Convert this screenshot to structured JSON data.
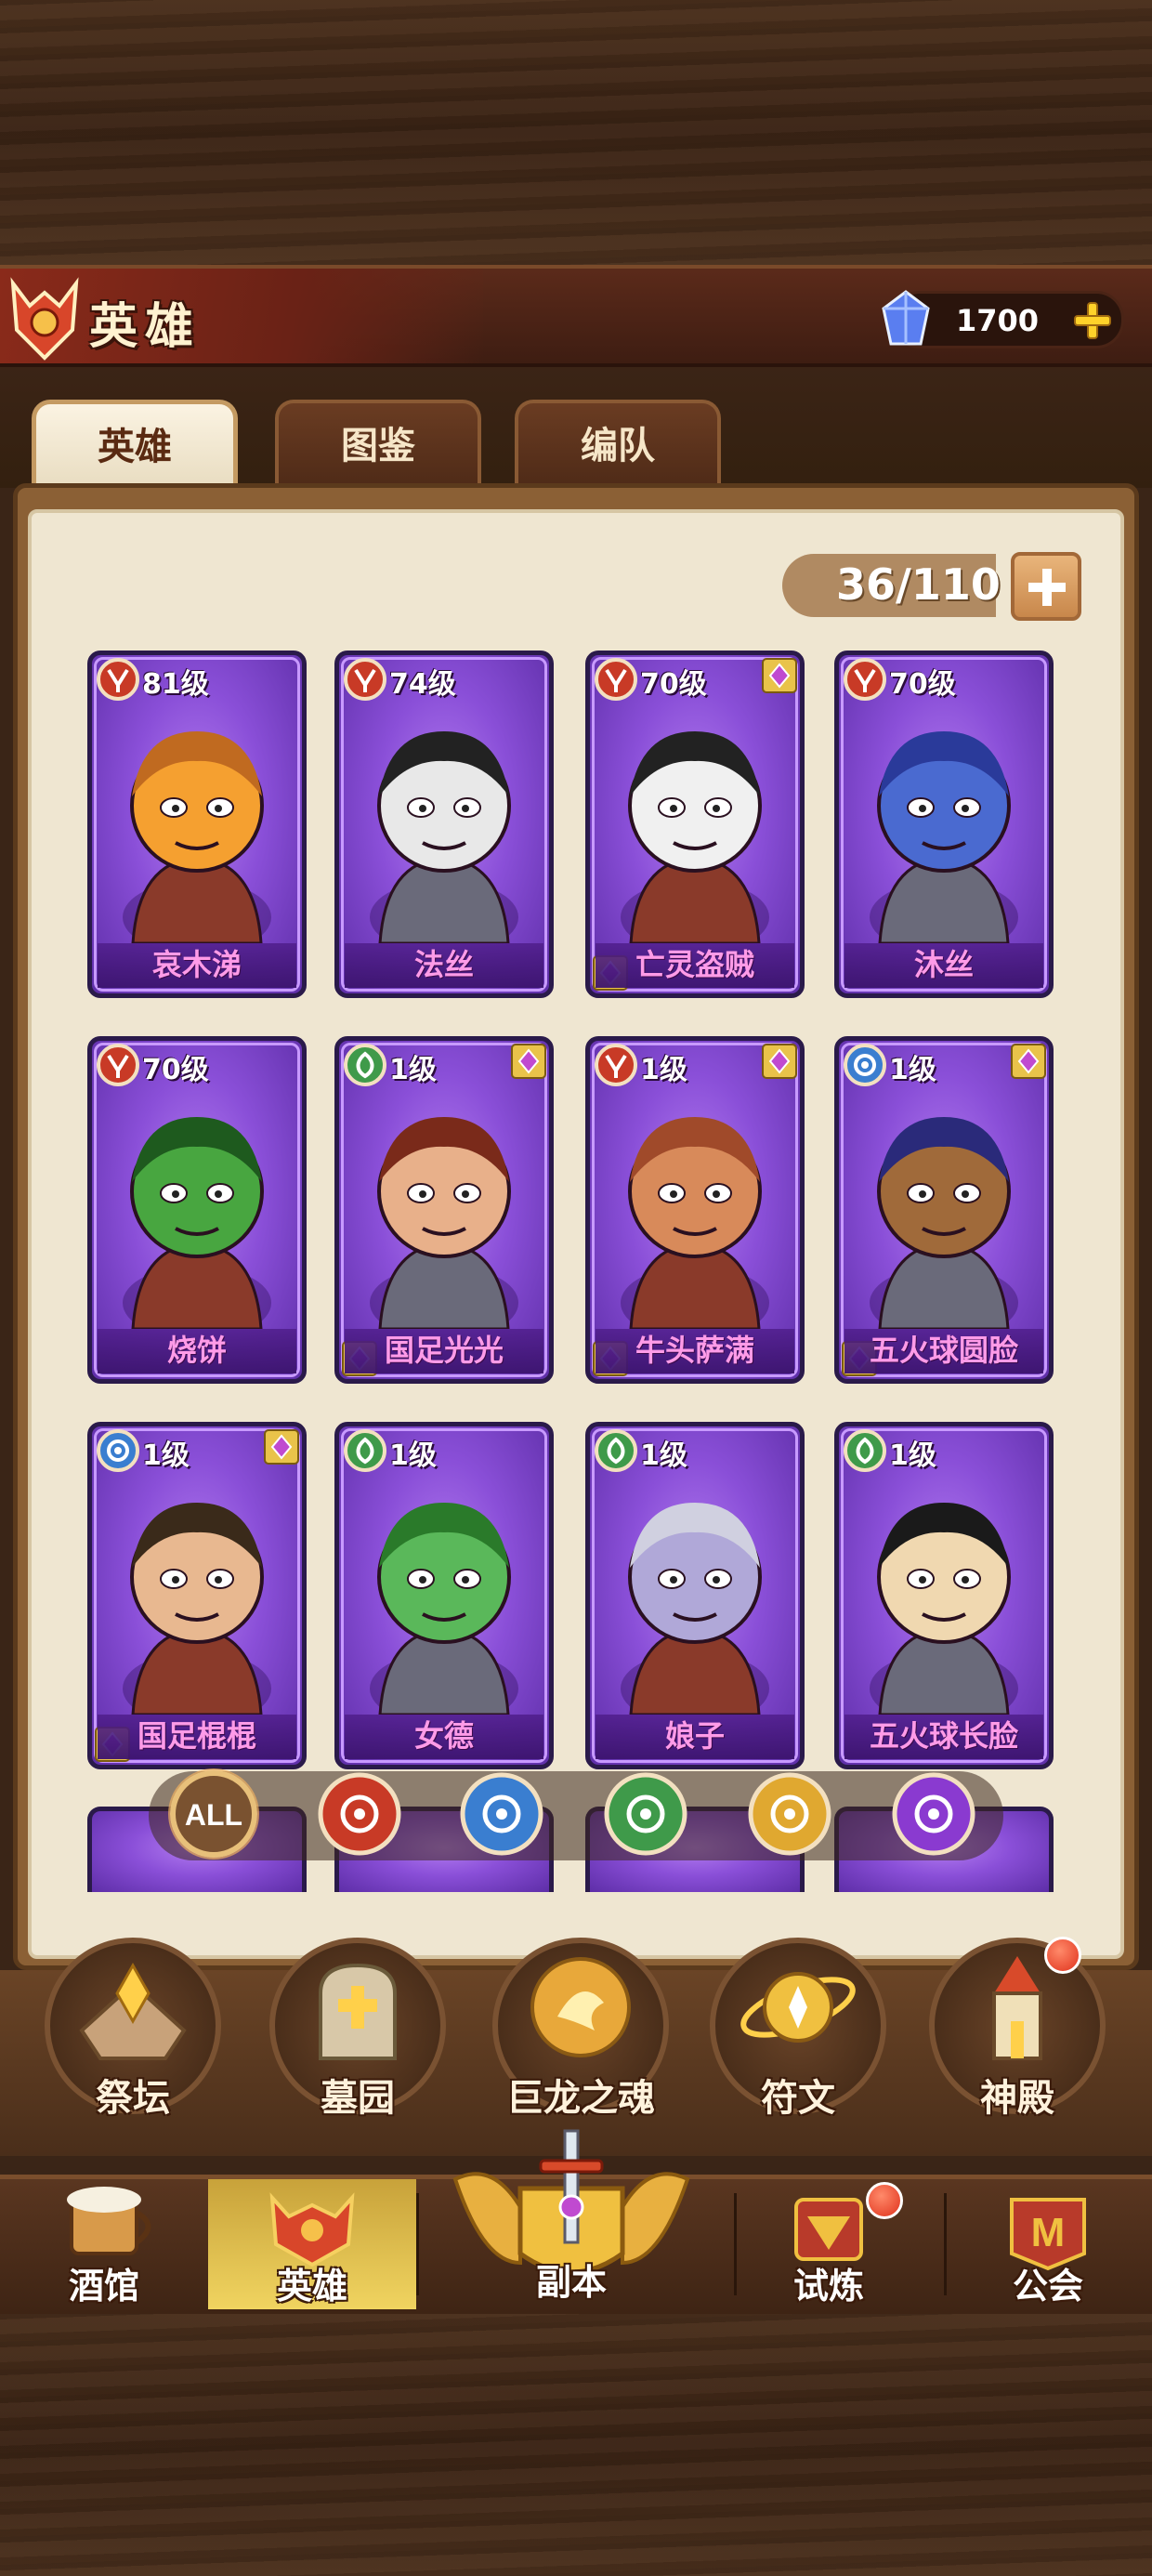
{
  "header": {
    "title": "英雄",
    "currency_value": "1700"
  },
  "tabs": [
    {
      "label": "英雄",
      "active": true
    },
    {
      "label": "图鉴",
      "active": false
    },
    {
      "label": "编队",
      "active": false
    }
  ],
  "hero_count": "36/110",
  "heroes": [
    {
      "level": "81级",
      "name": "哀木涕",
      "faction": "red",
      "rare": false
    },
    {
      "level": "74级",
      "name": "法丝",
      "faction": "red",
      "rare": false
    },
    {
      "level": "70级",
      "name": "亡灵盗贼",
      "faction": "red",
      "rare": true
    },
    {
      "level": "70级",
      "name": "沐丝",
      "faction": "red",
      "rare": false
    },
    {
      "level": "70级",
      "name": "烧饼",
      "faction": "red",
      "rare": false
    },
    {
      "level": "1级",
      "name": "国足光光",
      "faction": "green",
      "rare": true
    },
    {
      "level": "1级",
      "name": "牛头萨满",
      "faction": "red",
      "rare": true
    },
    {
      "level": "1级",
      "name": "五火球圆脸",
      "faction": "blue",
      "rare": true
    },
    {
      "level": "1级",
      "name": "国足棍棍",
      "faction": "blue",
      "rare": true
    },
    {
      "level": "1级",
      "name": "女德",
      "faction": "green",
      "rare": false
    },
    {
      "level": "1级",
      "name": "娘子",
      "faction": "green",
      "rare": false
    },
    {
      "level": "1级",
      "name": "五火球长脸",
      "faction": "green",
      "rare": false
    }
  ],
  "filters": [
    {
      "label": "ALL",
      "icon": "all-filter-icon",
      "color": "#c89a5a"
    },
    {
      "label": "",
      "icon": "horde-faction-icon",
      "color": "#c83a26"
    },
    {
      "label": "",
      "icon": "lion-faction-icon",
      "color": "#3a7ed0"
    },
    {
      "label": "",
      "icon": "nature-faction-icon",
      "color": "#3f9a4a"
    },
    {
      "label": "",
      "icon": "sun-faction-icon",
      "color": "#e0a830"
    },
    {
      "label": "",
      "icon": "eye-faction-icon",
      "color": "#8a3ad0"
    }
  ],
  "submenu": [
    {
      "label": "祭坛",
      "icon": "altar-icon"
    },
    {
      "label": "墓园",
      "icon": "tombstone-icon"
    },
    {
      "label": "巨龙之魂",
      "icon": "dragon-soul-icon"
    },
    {
      "label": "符文",
      "icon": "rune-icon"
    },
    {
      "label": "神殿",
      "icon": "temple-icon"
    }
  ],
  "bottom_nav": [
    {
      "label": "酒馆",
      "icon": "tavern-icon"
    },
    {
      "label": "英雄",
      "icon": "hero-helmet-icon"
    },
    {
      "label": "副本",
      "icon": "dungeon-sword-icon"
    },
    {
      "label": "试炼",
      "icon": "trial-icon"
    },
    {
      "label": "公会",
      "icon": "guild-icon"
    }
  ],
  "colors": {
    "card_purple": "#8a4fd8",
    "name_pink": "#ff9be8",
    "faction_red": "#c83a26",
    "faction_green": "#3f9a4a",
    "faction_blue": "#3a7ed0",
    "nav_active_gold": "#f0d460"
  }
}
